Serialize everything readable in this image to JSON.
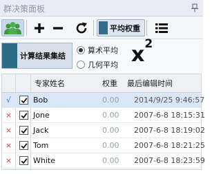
{
  "window": {
    "title": "群决策面板"
  },
  "toolbar": {
    "group_icon": "users-icon",
    "add_icon": "plus-icon",
    "remove_icon": "minus-icon",
    "refresh_icon": "refresh-icon",
    "weight_label": "平均权重",
    "list_icon": "list-icon"
  },
  "calc": {
    "button_label": "计算结果集结",
    "radio_arith": "算术平均",
    "radio_geo": "几何平均",
    "selected": "算术平均",
    "chi_base": "x",
    "chi_sup": "2"
  },
  "grid": {
    "headers": {
      "name": "专家姓名",
      "weight": "权重",
      "time": "最后编辑时间"
    },
    "rows": [
      {
        "mark": "√",
        "name": "Bob",
        "weight": "0.00",
        "time": "2014/9/25 9:46:57",
        "checked": true,
        "selected": true
      },
      {
        "mark": "×",
        "name": "Jone",
        "weight": "0.00",
        "time": "2007-6-8 18:15:31",
        "checked": true,
        "selected": false
      },
      {
        "mark": "×",
        "name": "Jack",
        "weight": "0.00",
        "time": "2007-6-8 18:19:02",
        "checked": true,
        "selected": false
      },
      {
        "mark": "×",
        "name": "Tom",
        "weight": "0.00",
        "time": "2007-6-8 18:21:25",
        "checked": true,
        "selected": false
      },
      {
        "mark": "×",
        "name": "White",
        "weight": "0.00",
        "time": "2007-6-8 18:23:59",
        "checked": true,
        "selected": false
      }
    ]
  },
  "colors": {
    "accent": "#2d6c86",
    "selected_row": "#d9e6f5",
    "mark_x": "#d43c3c",
    "mark_check": "#3a6fd0",
    "group_icon": "#3f9a3f"
  }
}
